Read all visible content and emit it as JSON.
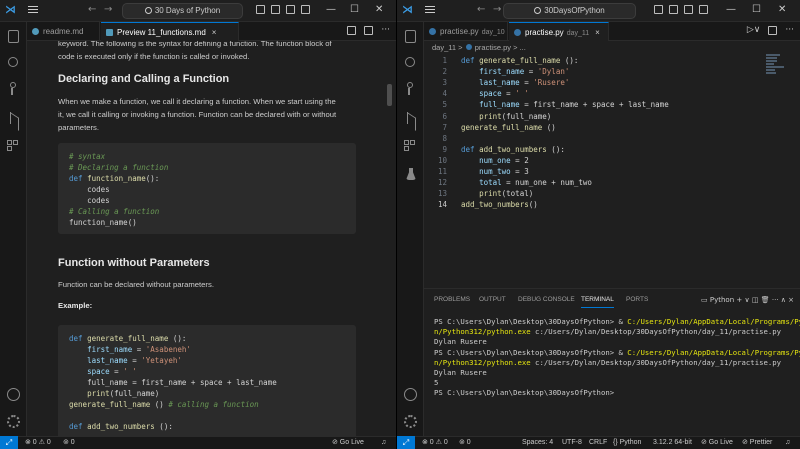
{
  "left_window": {
    "title": "30 Days of Python",
    "tabs": [
      {
        "label": "readme.md",
        "icon_color": "#519aba"
      },
      {
        "label": "Preview 11_functions.md",
        "icon_color": "#519aba",
        "close": "×"
      }
    ],
    "preview": {
      "intro_line1": "keyword. The following is the syntax for defining a function. The function block of",
      "intro_line2": "code is executed only if the function is called or invoked.",
      "heading1": "Declaring and Calling a Function",
      "para1_line1": "When we make a function, we call it declaring a function. When we start using the",
      "para1_line2": "it, we call it calling or invoking a function. Function can be declared with or without",
      "para1_line3": "parameters.",
      "code1": {
        "l1": "# syntax",
        "l2": "# Declaring a function",
        "l3_kw": "def",
        "l3_fn": "function_name",
        "l3_rest": "():",
        "l4": "codes",
        "l5": "codes",
        "l6": "# Calling a function",
        "l7": "function_name()"
      },
      "heading2": "Function without Parameters",
      "para2": "Function can be declared without parameters.",
      "example_label": "Example:",
      "code2": {
        "l1_kw": "def",
        "l1_fn": "generate_full_name",
        "l1_rest": " ():",
        "l2_var": "first_name",
        "l2_eq": " = ",
        "l2_str": "'Asabeneh'",
        "l3_var": "last_name",
        "l3_eq": " = ",
        "l3_str": "'Yetayeh'",
        "l4_var": "space",
        "l4_eq": " = ",
        "l4_str": "' '",
        "l5": "full_name = first_name + space + last_name",
        "l6_fn": "print",
        "l6_rest": "(full_name)",
        "l7_fn": "generate_full_name",
        "l7_rest": " () ",
        "l7_cm": "# calling a function",
        "l8_kw": "def",
        "l8_fn": "add_two_numbers",
        "l8_rest": " ():"
      }
    },
    "status": {
      "remote": "⤢",
      "problems": "⊗ 0 ⚠ 0",
      "ports": "⊚ 0",
      "golive": "⊘ Go Live",
      "bell": "♫"
    }
  },
  "right_window": {
    "title": "30DaysOfPython",
    "tabs": [
      {
        "label": "practise.py",
        "desc": "day_10",
        "icon_color": "#3572a5"
      },
      {
        "label": "practise.py",
        "desc": "day_11",
        "icon_color": "#3572a5",
        "close": "×"
      }
    ],
    "breadcrumb": {
      "folder": "day_11",
      "sep": ">",
      "file": "practise.py",
      "rest": "> ..."
    },
    "code_lines": [
      {
        "n": "1",
        "kw": "def ",
        "fn": "generate_full_name",
        "rest": " ():"
      },
      {
        "n": "2",
        "ind": "    ",
        "var": "first_name",
        "op": " = ",
        "str": "'Dylan'"
      },
      {
        "n": "3",
        "ind": "    ",
        "var": "last_name",
        "op": " = ",
        "str": "'Rusere'"
      },
      {
        "n": "4",
        "ind": "    ",
        "var": "space",
        "op": " = ",
        "str": "' '"
      },
      {
        "n": "5",
        "ind": "    ",
        "var": "full_name",
        "op": " = first_name + space + last_name"
      },
      {
        "n": "6",
        "ind": "    ",
        "fn": "print",
        "rest": "(full_name)"
      },
      {
        "n": "7",
        "fn": "generate_full_name",
        "rest": " ()"
      },
      {
        "n": "8"
      },
      {
        "n": "9",
        "kw": "def ",
        "fn": "add_two_numbers",
        "rest": " ():"
      },
      {
        "n": "10",
        "ind": "    ",
        "var": "num_one",
        "op": " = 2"
      },
      {
        "n": "11",
        "ind": "    ",
        "var": "num_two",
        "op": " = 3"
      },
      {
        "n": "12",
        "ind": "    ",
        "var": "total",
        "op": " = num_one + num_two"
      },
      {
        "n": "13",
        "ind": "    ",
        "fn": "print",
        "rest": "(total)"
      },
      {
        "n": "14",
        "fn": "add_two_numbers",
        "rest": "()"
      }
    ],
    "panel_tabs": [
      "PROBLEMS",
      "OUTPUT",
      "DEBUG CONSOLE",
      "TERMINAL",
      "PORTS"
    ],
    "panel_actions": {
      "shell": "Python",
      "plus": "+",
      "chev": "∨",
      "trash": "🗑",
      "dots": "···",
      "up": "∧",
      "close": "×"
    },
    "terminal": {
      "l1a": "PS C:\\Users\\Dylan\\Desktop\\30DaysOfPython> & ",
      "l1b": "C:/Users/Dylan/AppData/Local/Programs/Pytho",
      "l2a": "n/Python312/python.exe",
      "l2b": " c:/Users/Dylan/Desktop/30DaysOfPython/day_11/practise.py",
      "l3": "Dylan Rusere",
      "l4a": "PS C:\\Users\\Dylan\\Desktop\\30DaysOfPython> & ",
      "l4b": "C:/Users/Dylan/AppData/Local/Programs/Pytho",
      "l5a": "n/Python312/python.exe",
      "l5b": " c:/Users/Dylan/Desktop/30DaysOfPython/day_11/practise.py",
      "l6": "Dylan Rusere",
      "l7": "5",
      "l8": "PS C:\\Users\\Dylan\\Desktop\\30DaysOfPython>"
    },
    "status": {
      "remote": "⤢",
      "problems": "⊗ 0 ⚠ 0",
      "ports": "⊚ 0",
      "spaces": "Spaces: 4",
      "encoding": "UTF-8",
      "eol": "CRLF",
      "language": "{} Python",
      "interpreter": "3.12.2 64-bit",
      "golive": "⊘ Go Live",
      "prettier": "⊘ Prettier",
      "bell": "♫"
    }
  }
}
